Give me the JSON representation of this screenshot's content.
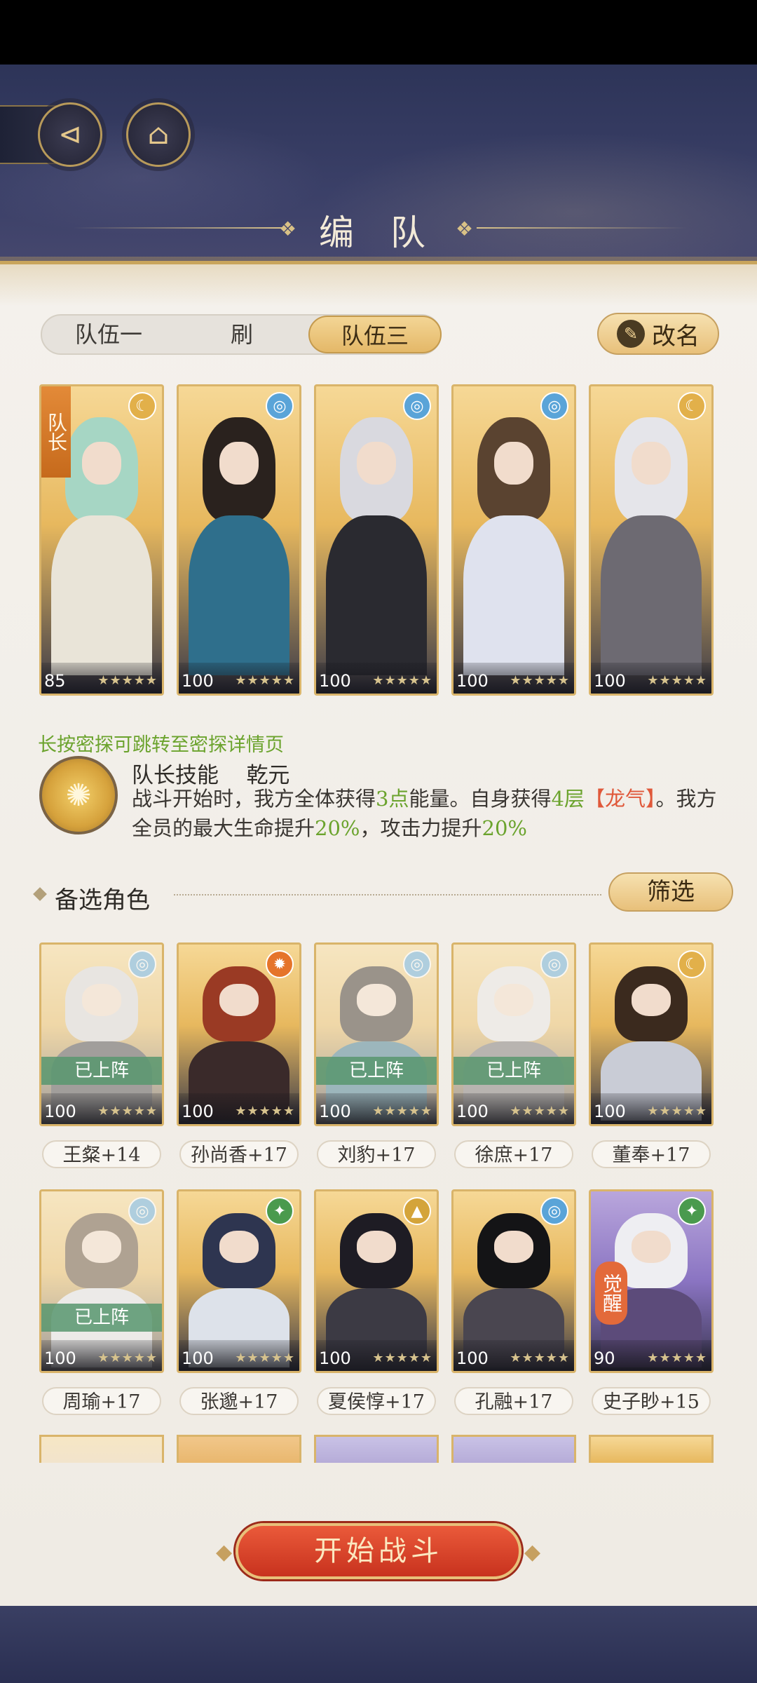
{
  "header": {
    "title": "编 队",
    "back_icon": "back-arrow-icon",
    "home_icon": "pavilion-icon"
  },
  "tabs": [
    {
      "label": "队伍一",
      "active": false
    },
    {
      "label": "刷",
      "active": false
    },
    {
      "label": "队伍三",
      "active": true
    }
  ],
  "rename_button": {
    "label": "改名",
    "icon": "brush-icon"
  },
  "team": {
    "captain_label": "队长",
    "members": [
      {
        "level": "85",
        "element": "moon",
        "stars": "★★★★★",
        "hair": "#a6d6c4",
        "robe": "#e9e4d8"
      },
      {
        "level": "100",
        "element": "water",
        "stars": "★★★★★",
        "hair": "#2a221e",
        "robe": "#2f6f8c"
      },
      {
        "level": "100",
        "element": "water",
        "stars": "★★★★★",
        "hair": "#d9d9df",
        "robe": "#2a2a30"
      },
      {
        "level": "100",
        "element": "water",
        "stars": "★★★★★",
        "hair": "#5a4330",
        "robe": "#dfe2ee"
      },
      {
        "level": "100",
        "element": "moon",
        "stars": "★★★★★",
        "hair": "#e5e5ea",
        "robe": "#6d6a72"
      }
    ]
  },
  "hint_text": "长按密探可跳转至密探详情页",
  "captain_skill": {
    "label": "队长技能",
    "name": "乾元",
    "desc_1": "战斗开始时，我方全体获得",
    "value_1": "3点",
    "desc_2": "能量。自身获得",
    "value_2": "4层",
    "keyword": "【龙气】",
    "desc_3": "。我方全员的最大生命提升",
    "value_3": "20%",
    "desc_4": "，攻击力提升",
    "value_4": "20%"
  },
  "roster_section": {
    "title": "备选角色",
    "filter_label": "筛选"
  },
  "deployed_label": "已上阵",
  "awaken_label": "觉醒",
  "roster": [
    {
      "name": "王粲+14",
      "level": "100",
      "element": "water",
      "deployed": true,
      "awaken": false,
      "hair": "#d8d8de",
      "robe": "#3a3a44"
    },
    {
      "name": "孙尚香+17",
      "level": "100",
      "element": "fire",
      "deployed": false,
      "awaken": false,
      "hair": "#9a3a24",
      "robe": "#3a2a2a"
    },
    {
      "name": "刘豹+17",
      "level": "100",
      "element": "water",
      "deployed": true,
      "awaken": false,
      "hair": "#2a221e",
      "robe": "#2f6f8c"
    },
    {
      "name": "徐庶+17",
      "level": "100",
      "element": "water",
      "deployed": true,
      "awaken": false,
      "hair": "#e5e5ea",
      "robe": "#6d6a72"
    },
    {
      "name": "董奉+17",
      "level": "100",
      "element": "moon",
      "deployed": false,
      "awaken": false,
      "hair": "#3b2a1e",
      "robe": "#c9ccd6"
    },
    {
      "name": "周瑜+17",
      "level": "100",
      "element": "water",
      "deployed": true,
      "awaken": false,
      "hair": "#5a4330",
      "robe": "#dfe2ee"
    },
    {
      "name": "张邈+17",
      "level": "100",
      "element": "wind",
      "deployed": false,
      "awaken": false,
      "hair": "#2e3550",
      "robe": "#dde2ea"
    },
    {
      "name": "夏侯惇+17",
      "level": "100",
      "element": "earth",
      "deployed": false,
      "awaken": false,
      "hair": "#1e1c24",
      "robe": "#3c3a44"
    },
    {
      "name": "孔融+17",
      "level": "100",
      "element": "water",
      "deployed": false,
      "awaken": false,
      "hair": "#141416",
      "robe": "#4a4650"
    },
    {
      "name": "史子眇+15",
      "level": "90",
      "element": "wind",
      "deployed": false,
      "awaken": true,
      "hair": "#eeeef2",
      "robe": "#5c4b7a"
    }
  ],
  "start_button": {
    "label": "开始战斗"
  },
  "colors": {
    "accent_gold": "#e4b868",
    "panel_bg": "#f4f1ec",
    "highlight_green": "#6ba32d",
    "highlight_red": "#e0583a",
    "start_red": "#d23f26",
    "water": "#5aa4d8",
    "moon": "#e2b04a",
    "fire": "#e5742a",
    "wind": "#4a9a4e",
    "earth": "#d4a43a"
  }
}
